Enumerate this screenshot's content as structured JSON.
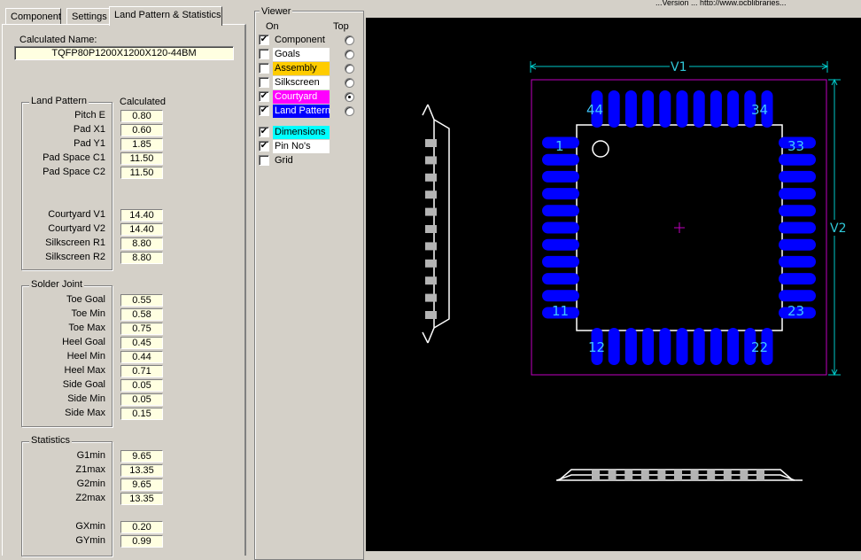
{
  "tabs": [
    "Component",
    "Settings",
    "Land Pattern & Statistics"
  ],
  "calculated_name_label": "Calculated Name:",
  "calculated_name": "TQFP80P1200X1200X120-44BM",
  "land_pattern": {
    "title": "Land Pattern",
    "column_header": "Calculated",
    "rows": [
      {
        "label": "Pitch E",
        "value": "0.80"
      },
      {
        "label": "Pad X1",
        "value": "0.60"
      },
      {
        "label": "Pad Y1",
        "value": "1.85"
      },
      {
        "label": "Pad Space C1",
        "value": "11.50"
      },
      {
        "label": "Pad Space C2",
        "value": "11.50"
      },
      {
        "label": "Courtyard V1",
        "value": "14.40"
      },
      {
        "label": "Courtyard V2",
        "value": "14.40"
      },
      {
        "label": "Silkscreen R1",
        "value": "8.80"
      },
      {
        "label": "Silkscreen R2",
        "value": "8.80"
      }
    ]
  },
  "solder_joint": {
    "title": "Solder Joint",
    "rows": [
      {
        "label": "Toe Goal",
        "value": "0.55"
      },
      {
        "label": "Toe Min",
        "value": "0.58"
      },
      {
        "label": "Toe Max",
        "value": "0.75"
      },
      {
        "label": "Heel Goal",
        "value": "0.45"
      },
      {
        "label": "Heel Min",
        "value": "0.44"
      },
      {
        "label": "Heel Max",
        "value": "0.71"
      },
      {
        "label": "Side Goal",
        "value": "0.05"
      },
      {
        "label": "Side Min",
        "value": "0.05"
      },
      {
        "label": "Side Max",
        "value": "0.15"
      }
    ]
  },
  "statistics": {
    "title": "Statistics",
    "rows": [
      {
        "label": "G1min",
        "value": "9.65"
      },
      {
        "label": "Z1max",
        "value": "13.35"
      },
      {
        "label": "G2min",
        "value": "9.65"
      },
      {
        "label": "Z2max",
        "value": "13.35"
      },
      {
        "label": "GXmin",
        "value": "0.20"
      },
      {
        "label": "GYmin",
        "value": "0.99"
      }
    ]
  },
  "viewer": {
    "title": "Viewer",
    "col_on": "On",
    "col_top": "Top",
    "layers": [
      {
        "name": "Component",
        "checked": true,
        "color": "#d4d0c8",
        "text_color": "#000000",
        "radio": true,
        "radio_on": false
      },
      {
        "name": "Goals",
        "checked": false,
        "color": "#ffffff",
        "text_color": "#000000",
        "radio": true,
        "radio_on": false
      },
      {
        "name": "Assembly",
        "checked": false,
        "color": "#ffcc00",
        "text_color": "#000000",
        "radio": true,
        "radio_on": false
      },
      {
        "name": "Silkscreen",
        "checked": false,
        "color": "#ffffff",
        "text_color": "#000000",
        "radio": true,
        "radio_on": false
      },
      {
        "name": "Courtyard",
        "checked": true,
        "color": "#ff00ff",
        "text_color": "#ffffff",
        "radio": true,
        "radio_on": true
      },
      {
        "name": "Land Pattern",
        "checked": true,
        "color": "#0000ff",
        "text_color": "#ffffff",
        "radio": true,
        "radio_on": false
      },
      {
        "name": "Dimensions",
        "checked": true,
        "color": "#00ffff",
        "text_color": "#000000",
        "radio": false,
        "radio_on": false
      },
      {
        "name": "Pin No's",
        "checked": true,
        "color": "#ffffff",
        "text_color": "#000000",
        "radio": false,
        "radio_on": false
      },
      {
        "name": "Grid",
        "checked": false,
        "color": "#d4d0c8",
        "text_color": "#000000",
        "radio": false,
        "radio_on": false
      }
    ]
  },
  "drawing": {
    "dim_v1": "V1",
    "dim_v2": "V2",
    "pin_labels": [
      "1",
      "11",
      "12",
      "22",
      "23",
      "33",
      "34",
      "44"
    ],
    "colors": {
      "pad": "#0000ff",
      "courtyard": "#c000c0",
      "outline": "#ffffff",
      "dimension": "#00c8c8",
      "pin_label": "#40c8ff"
    }
  },
  "top_strip_text": "...Version ...  http://www.pcblibraries..."
}
